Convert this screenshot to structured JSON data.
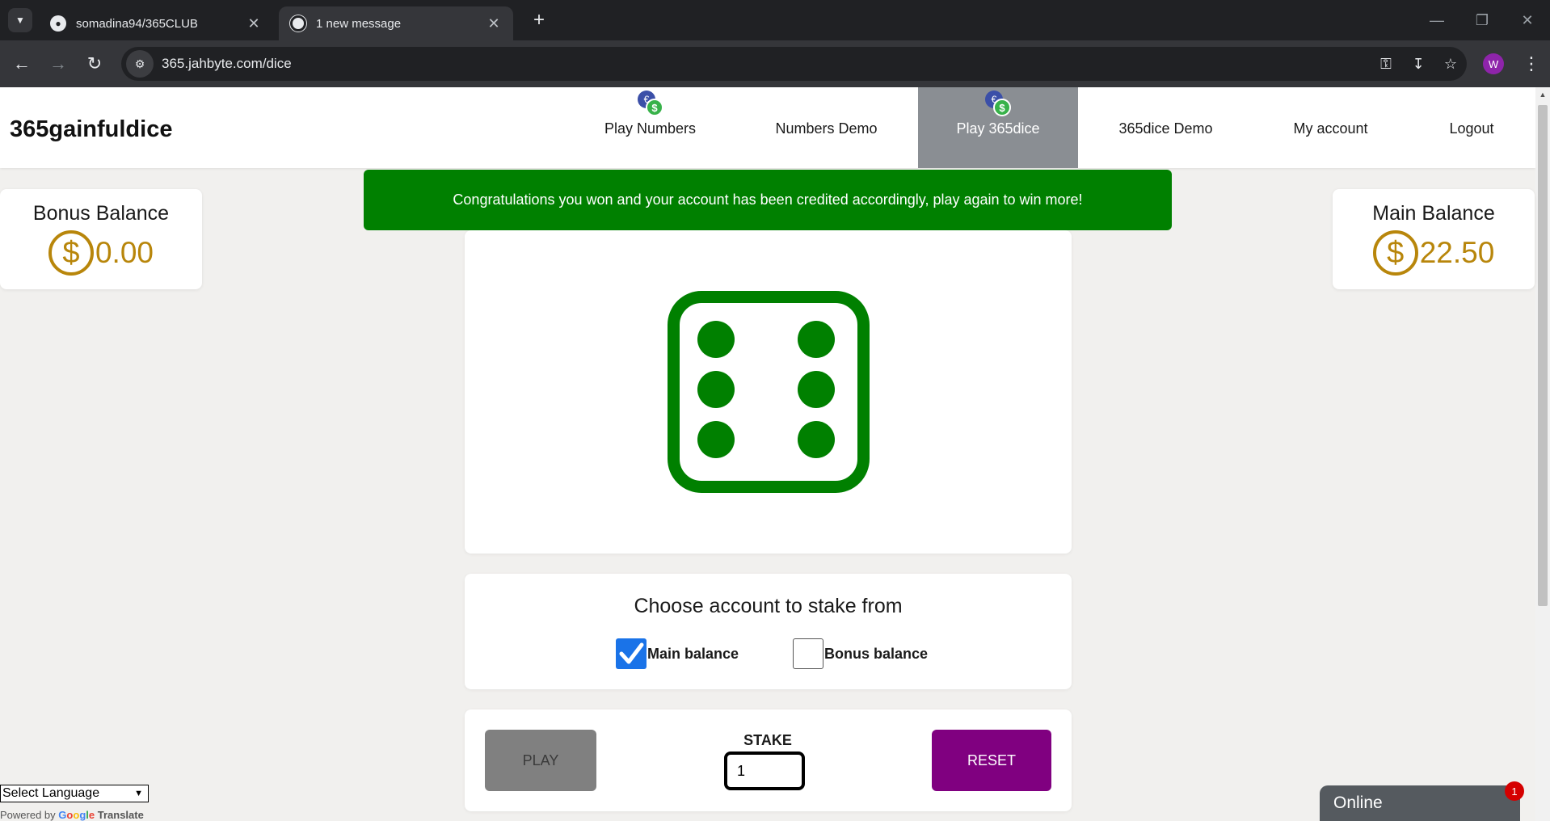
{
  "browser": {
    "tabs": [
      {
        "title": "somadina94/365CLUB",
        "close": "✕"
      },
      {
        "title": "1 new message",
        "close": "✕"
      }
    ],
    "new_tab": "+",
    "url": "365.jahbyte.com/dice",
    "profile_initial": "W"
  },
  "header": {
    "brand": "365gainfuldice",
    "nav": [
      {
        "label": "Play Numbers",
        "has_coin_icon": true,
        "active": false
      },
      {
        "label": "Numbers Demo",
        "has_coin_icon": false,
        "active": false
      },
      {
        "label": "Play 365dice",
        "has_coin_icon": true,
        "active": true
      },
      {
        "label": "365dice Demo",
        "has_coin_icon": false,
        "active": false
      },
      {
        "label": "My account",
        "has_coin_icon": false,
        "active": false
      },
      {
        "label": "Logout",
        "has_coin_icon": false,
        "active": false
      }
    ]
  },
  "alert": {
    "message": "Congratulations you won and your account has been credited accordingly, play again to win more!",
    "color": "#008000"
  },
  "bonus_balance": {
    "label": "Bonus Balance",
    "currency_symbol": "$",
    "amount": "0.00"
  },
  "main_balance": {
    "label": "Main Balance",
    "currency_symbol": "$",
    "amount": "22.50"
  },
  "dice": {
    "face_value": 6,
    "color": "#008000"
  },
  "stake_account": {
    "heading": "Choose account to stake from",
    "options": [
      {
        "label": "Main balance",
        "checked": true
      },
      {
        "label": "Bonus balance",
        "checked": false
      }
    ]
  },
  "controls": {
    "play_label": "PLAY",
    "stake_label": "STAKE",
    "stake_value": "1",
    "reset_label": "RESET",
    "reset_color": "#800080",
    "play_color": "#808080"
  },
  "translate": {
    "select_label": "Select Language",
    "powered_by": "Powered by",
    "google": "Google",
    "translate_word": "Translate"
  },
  "chat": {
    "status": "Online",
    "unread_count": "1"
  },
  "colors": {
    "gold": "#b8860b",
    "checkbox_blue": "#1a73e8"
  }
}
